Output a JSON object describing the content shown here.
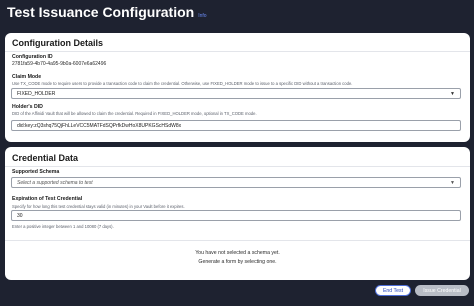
{
  "header": {
    "title": "Test Issuance Configuration",
    "info_label": "Info"
  },
  "configuration": {
    "section_title": "Configuration Details",
    "config_id_label": "Configuration ID",
    "config_id_value": "2781fa59-4b70-4a95-9b0a-6007e6a62496",
    "claim_mode_label": "Claim Mode",
    "claim_mode_help": "Use TX_CODE mode to require users to provide a transaction code to claim the credential. Otherwise, use FIXED_HOLDER mode to issue to a specific DID without a transaction code.",
    "claim_mode_value": "FIXED_HOLDER",
    "holder_did_label": "Holder's DID",
    "holder_did_help": "DID of the Affinidi Vault that will be allowed to claim the credential. Required in FIXED_HOLDER mode, optional in TX_CODE mode.",
    "holder_did_value": "did:key:zQ3shq75QjFhLLeVCC5MATFdSQPrfkDwHoX8UPKGScHSdW8x"
  },
  "credential": {
    "section_title": "Credential Data",
    "schema_label": "Supported Schema",
    "schema_placeholder": "Select a supported schema to test",
    "expiration_label": "Expiration of Test Credential",
    "expiration_help": "Specify for how long this test credential stays valid (in minutes) in your Vault before it expires.",
    "expiration_value": "30",
    "expiration_hint": "Enter a positive integer between 1 and 10080 (7 days).",
    "empty_line1": "You have not selected a schema yet.",
    "empty_line2": "Generate a form by selecting one."
  },
  "footer": {
    "end_test_label": "End Test",
    "issue_label": "Issue Credential"
  },
  "colors": {
    "background": "#1e2230",
    "accent": "#4f6fd9",
    "disabled_button": "#b9bdc6"
  }
}
